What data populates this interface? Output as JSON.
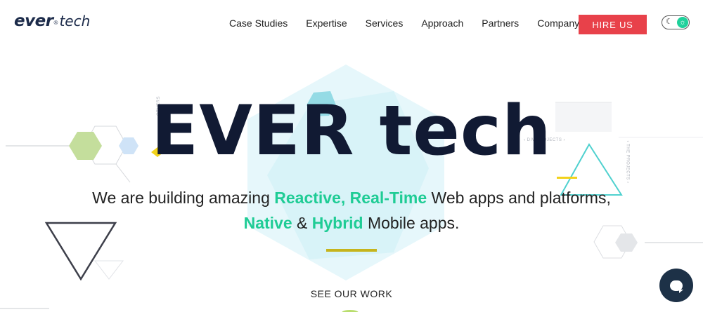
{
  "header": {
    "logo": {
      "brand": "ever",
      "mark": "®",
      "suffix": "tech"
    },
    "nav": [
      {
        "label": "Case Studies"
      },
      {
        "label": "Expertise"
      },
      {
        "label": "Services"
      },
      {
        "label": "Approach"
      },
      {
        "label": "Partners"
      },
      {
        "label": "Company",
        "has_dropdown": true
      }
    ],
    "company_caret": "▾",
    "hire_label": "HIRE US",
    "theme_toggle": {
      "moon_icon": "moon-icon",
      "sun_icon": "sun-icon",
      "moon_glyph": "☾",
      "sun_glyph": "☼"
    }
  },
  "hero": {
    "title": "EVER tech",
    "line1_prefix": "We are building amazing ",
    "line1_highlight": "Reactive, Real-Time",
    "line1_suffix": " Web apps and platforms,",
    "line2_highlight1": "Native",
    "line2_mid": " & ",
    "line2_highlight2": "Hybrid",
    "line2_suffix": " Mobile apps.",
    "cta": "SEE OUR WORK"
  },
  "decor_labels": {
    "left": "OTHERS",
    "right": "‹ DIV PROJECTS ›",
    "far_right": "‹ THE PROJECTS ›"
  },
  "colors": {
    "brand_navy": "#1c2b4a",
    "accent_green": "#1fcc95",
    "hire_red": "#e8414a",
    "divider_gold": "#c6b41c",
    "chat_navy": "#1d3147"
  },
  "chat": {
    "icon": "chat-icon"
  }
}
